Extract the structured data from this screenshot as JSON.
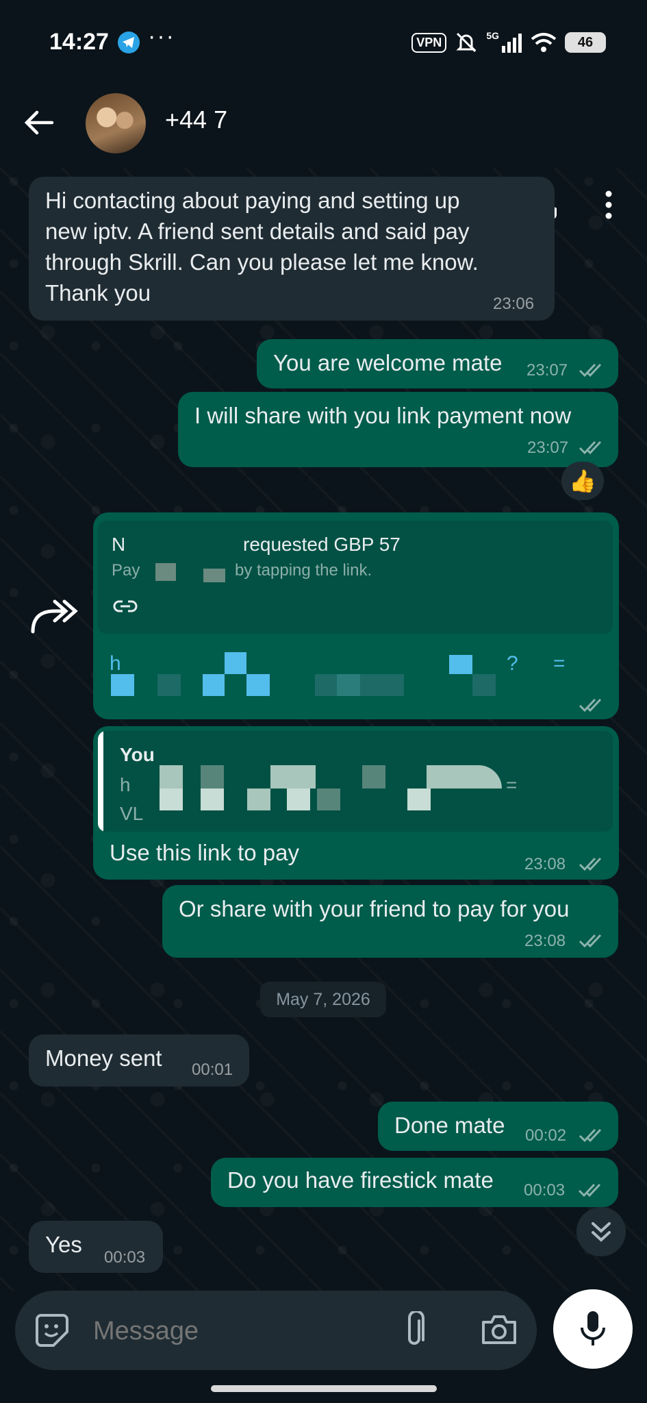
{
  "status_bar": {
    "time": "14:27",
    "more": "···",
    "vpn": "VPN",
    "network": "5G",
    "battery": "46"
  },
  "header": {
    "contact": "+44 7"
  },
  "messages": [
    {
      "dir": "in",
      "text_lines": [
        "Hi contacting about paying and setting up",
        "new iptv. A friend sent details and said pay",
        "through Skrill. Can you please let me know.",
        "Thank you"
      ],
      "time": "23:06"
    },
    {
      "dir": "out",
      "text": "You are welcome mate",
      "time": "23:07"
    },
    {
      "dir": "out",
      "text": "I will share with you link payment now",
      "time": "23:07",
      "reaction": "👍"
    },
    {
      "dir": "out",
      "type": "payment-link",
      "title": "requested GBP 57",
      "title_prefix": "N",
      "subtitle": "by tapping the link.",
      "subtitle_prefix": "Pay",
      "link_prefix": "h",
      "link_suffix": "?",
      "link_end": "="
    },
    {
      "dir": "out",
      "quote_author": "You",
      "quote_line1": "h",
      "quote_line1_end": "=",
      "quote_line2": "VL",
      "text": "Use this link to pay",
      "time": "23:08"
    },
    {
      "dir": "out",
      "text": "Or share with your friend to pay for you",
      "time": "23:08"
    },
    {
      "dir": "in",
      "text": "Money sent",
      "time": "00:01"
    },
    {
      "dir": "out",
      "text": "Done mate",
      "time": "00:02"
    },
    {
      "dir": "out",
      "text": "Do you have firestick mate",
      "time": "00:03"
    },
    {
      "dir": "in",
      "text": "Yes",
      "time": "00:03"
    }
  ],
  "date_separator": "May 7, 2026",
  "composer": {
    "placeholder": "Message"
  },
  "colors": {
    "background": "#0b141a",
    "incoming": "#202c33",
    "outgoing": "#005c4b",
    "link": "#53bdeb"
  }
}
